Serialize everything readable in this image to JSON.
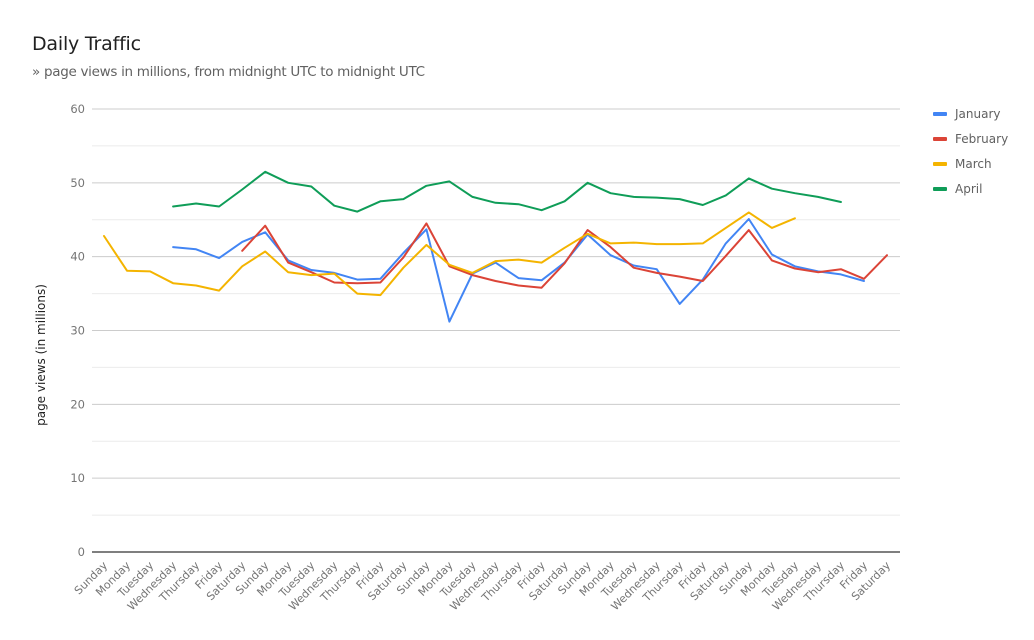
{
  "chart_data": {
    "type": "line",
    "title": "Daily Traffic",
    "subtitle": "» page views in millions, from midnight UTC to midnight UTC",
    "xlabel": "",
    "ylabel": "page views (in millions)",
    "ylim": [
      0,
      60
    ],
    "yticks": [
      0,
      10,
      20,
      30,
      40,
      50,
      60
    ],
    "minor_grid_step": 5,
    "grid": true,
    "legend_position": "right",
    "categories": [
      "Sunday",
      "Monday",
      "Tuesday",
      "Wednesday",
      "Thursday",
      "Friday",
      "Saturday",
      "Sunday",
      "Monday",
      "Tuesday",
      "Wednesday",
      "Thursday",
      "Friday",
      "Saturday",
      "Sunday",
      "Monday",
      "Tuesday",
      "Wednesday",
      "Thursday",
      "Friday",
      "Saturday",
      "Sunday",
      "Monday",
      "Tuesday",
      "Wednesday",
      "Thursday",
      "Friday",
      "Saturday",
      "Sunday",
      "Monday",
      "Tuesday",
      "Wednesday",
      "Thursday",
      "Friday",
      "Saturday"
    ],
    "series": [
      {
        "name": "January",
        "color": "#4285f4",
        "values": [
          null,
          null,
          null,
          41.3,
          41.0,
          39.8,
          42.0,
          43.3,
          39.5,
          38.2,
          37.8,
          36.9,
          37.0,
          40.5,
          43.7,
          31.2,
          37.7,
          39.2,
          37.1,
          36.8,
          39.2,
          43.0,
          40.2,
          38.8,
          38.3,
          33.6,
          36.9,
          41.8,
          45.1,
          40.3,
          38.7,
          38.0,
          37.6,
          36.7,
          null
        ]
      },
      {
        "name": "February",
        "color": "#db4437",
        "values": [
          null,
          null,
          null,
          null,
          null,
          null,
          40.8,
          44.2,
          39.2,
          37.9,
          36.5,
          36.4,
          36.5,
          39.9,
          44.5,
          38.7,
          37.5,
          36.7,
          36.1,
          35.8,
          39.1,
          43.6,
          41.3,
          38.5,
          37.8,
          37.3,
          36.7,
          40.1,
          43.6,
          39.5,
          38.4,
          37.9,
          38.3,
          37.0,
          40.2
        ]
      },
      {
        "name": "March",
        "color": "#f4b400",
        "values": [
          42.8,
          38.1,
          38.0,
          36.4,
          36.1,
          35.4,
          38.7,
          40.7,
          37.9,
          37.5,
          37.7,
          35.0,
          34.8,
          38.5,
          41.6,
          38.9,
          37.8,
          39.4,
          39.6,
          39.2,
          41.2,
          43.1,
          41.8,
          41.9,
          41.7,
          41.7,
          41.8,
          43.9,
          46.0,
          43.9,
          45.2,
          null,
          null,
          null,
          null
        ]
      },
      {
        "name": "April",
        "color": "#0f9d58",
        "values": [
          null,
          null,
          null,
          46.8,
          47.2,
          46.8,
          49.1,
          51.5,
          50.0,
          49.5,
          46.9,
          46.1,
          47.5,
          47.8,
          49.6,
          50.2,
          48.1,
          47.3,
          47.1,
          46.3,
          47.5,
          50.0,
          48.6,
          48.1,
          48.0,
          47.8,
          47.0,
          48.3,
          50.6,
          49.2,
          48.6,
          48.1,
          47.4,
          null,
          null
        ]
      }
    ]
  }
}
